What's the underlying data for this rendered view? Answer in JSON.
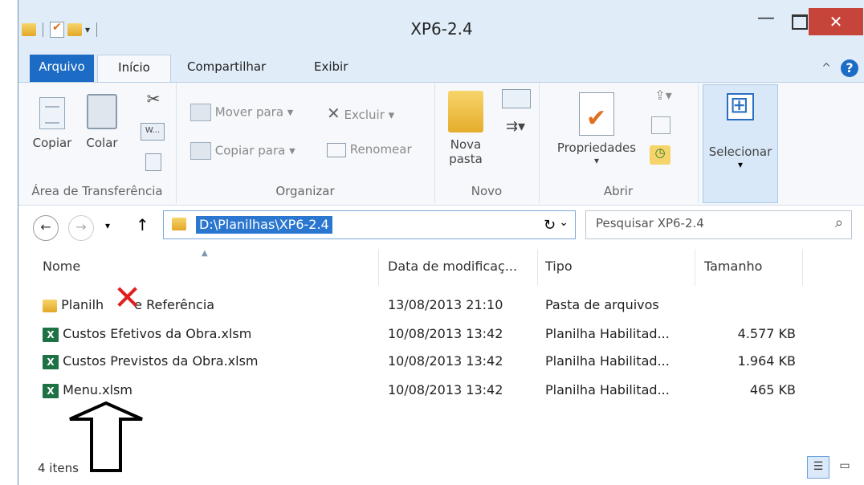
{
  "window": {
    "title": "XP6-2.4",
    "close_label": "✕",
    "minimize_label": "—"
  },
  "ribbon_tabs": {
    "file": "Arquivo",
    "home": "Início",
    "share": "Compartilhar",
    "view": "Exibir"
  },
  "ribbon": {
    "clipboard": {
      "copy": "Copiar",
      "paste": "Colar",
      "group": "Área de Transferência"
    },
    "organize": {
      "move_to": "Mover para",
      "copy_to": "Copiar para",
      "delete": "Excluir",
      "rename": "Renomear",
      "group": "Organizar"
    },
    "new": {
      "new_folder_line1": "Nova",
      "new_folder_line2": "pasta",
      "group": "Novo"
    },
    "open": {
      "properties": "Propriedades",
      "group": "Abrir"
    },
    "select": {
      "select": "Selecionar"
    }
  },
  "address": {
    "path": "D:\\Planilhas\\XP6-2.4",
    "search_placeholder": "Pesquisar XP6-2.4"
  },
  "columns": {
    "name": "Nome",
    "date": "Data de modificaç...",
    "type": "Tipo",
    "size": "Tamanho"
  },
  "files": [
    {
      "name": "Planilh",
      "name_tail": "e Referência",
      "date": "13/08/2013 21:10",
      "type": "Pasta de arquivos",
      "size": "",
      "icon": "folder-icon"
    },
    {
      "name": "Custos Efetivos da Obra.xlsm",
      "date": "10/08/2013 13:42",
      "type": "Planilha Habilitad...",
      "size": "4.577 KB",
      "icon": "excel-icon"
    },
    {
      "name": "Custos Previstos da Obra.xlsm",
      "date": "10/08/2013 13:42",
      "type": "Planilha Habilitad...",
      "size": "1.964 KB",
      "icon": "excel-icon"
    },
    {
      "name": "Menu.xlsm",
      "date": "10/08/2013 13:42",
      "type": "Planilha Habilitad...",
      "size": "465 KB",
      "icon": "excel-icon"
    }
  ],
  "status": {
    "item_count": "4 itens"
  },
  "annotations": {
    "red_x": "✕",
    "arrow": "up-arrow"
  },
  "colors": {
    "accent": "#1c6bc4",
    "close": "#c7443a",
    "excel": "#1e7145"
  }
}
